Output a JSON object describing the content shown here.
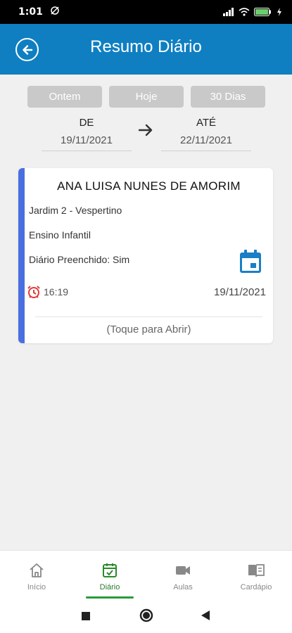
{
  "status": {
    "time": "1:01"
  },
  "appbar": {
    "title": "Resumo Diário"
  },
  "filters": [
    {
      "label": "Ontem"
    },
    {
      "label": "Hoje"
    },
    {
      "label": "30 Dias"
    }
  ],
  "range": {
    "from_label": "DE",
    "from_value": "19/11/2021",
    "to_label": "ATÉ",
    "to_value": "22/11/2021"
  },
  "card": {
    "name": "ANA LUISA NUNES DE AMORIM",
    "class": "Jardim 2 - Vespertino",
    "level": "Ensino Infantil",
    "filled": "Diário Preenchido: Sim",
    "time": "16:19",
    "date": "19/11/2021",
    "hint": "(Toque para Abrir)"
  },
  "nav": {
    "items": [
      {
        "label": "Início",
        "icon": "home-icon"
      },
      {
        "label": "Diário",
        "icon": "calendar-check-icon",
        "active": true
      },
      {
        "label": "Aulas",
        "icon": "video-icon"
      },
      {
        "label": "Cardápio",
        "icon": "book-icon"
      }
    ]
  },
  "colors": {
    "appbar": "#0f7fc2",
    "accent_bar": "#4a6fe0",
    "active_nav": "#2a9a3a",
    "alarm": "#e23a3a",
    "calendar": "#1a7fc4"
  }
}
